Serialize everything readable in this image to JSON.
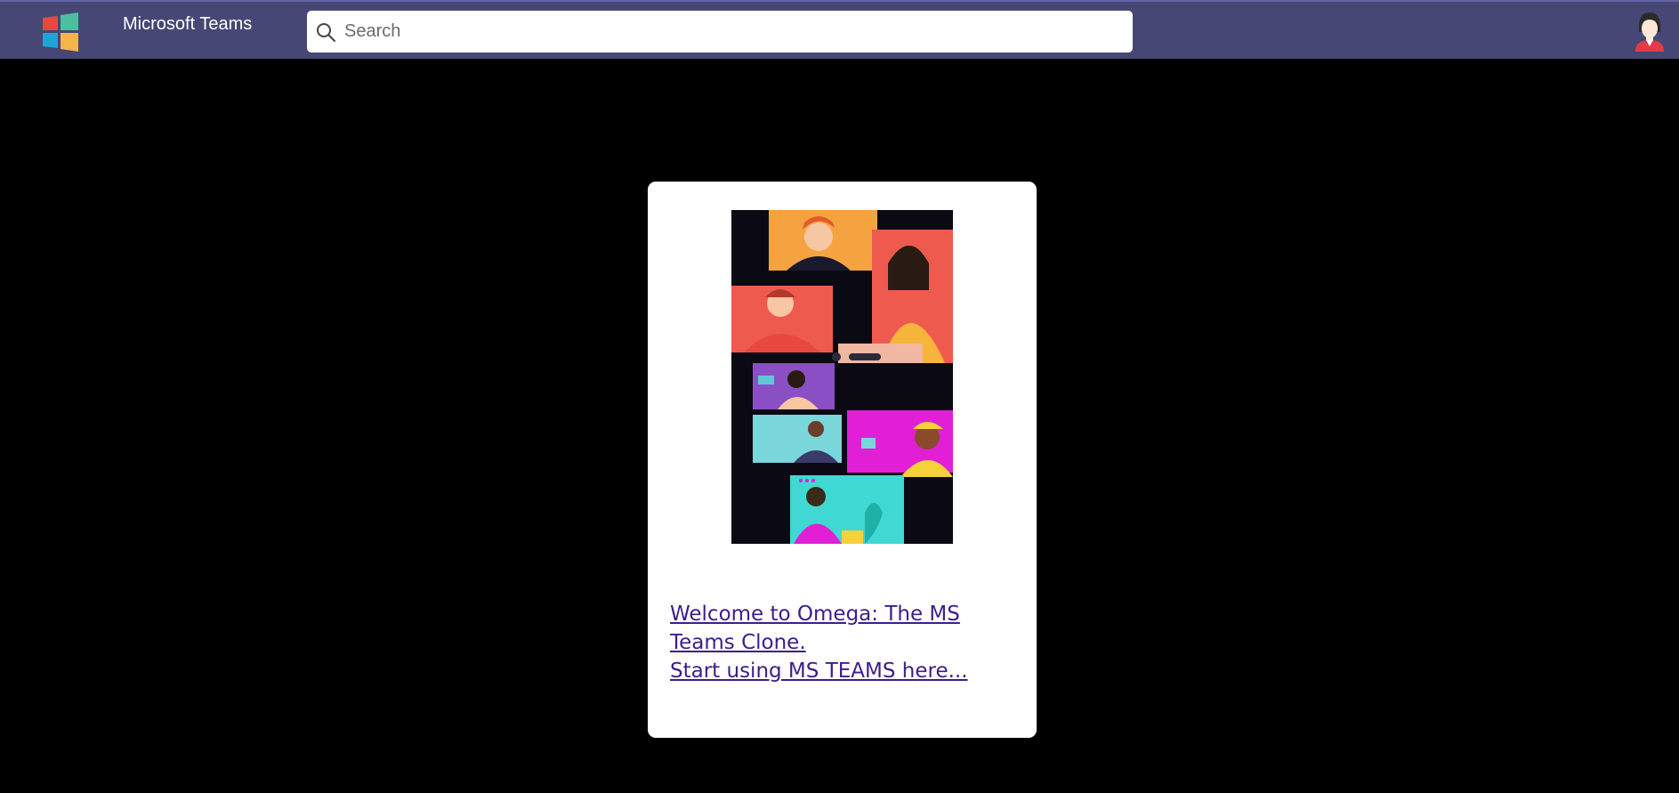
{
  "header": {
    "app_title": "Microsoft Teams",
    "logo_icon": "windows-logo-icon",
    "avatar_icon": "user-avatar-icon",
    "background": "#464775"
  },
  "search": {
    "placeholder": "Search",
    "value": "",
    "icon": "search-icon"
  },
  "welcome_card": {
    "image_icon": "video-call-illustration",
    "link_line_1": "Welcome to Omega: The MS Teams Clone.",
    "link_line_2": "Start using MS TEAMS here...",
    "link_color": "#3b1f8c"
  }
}
